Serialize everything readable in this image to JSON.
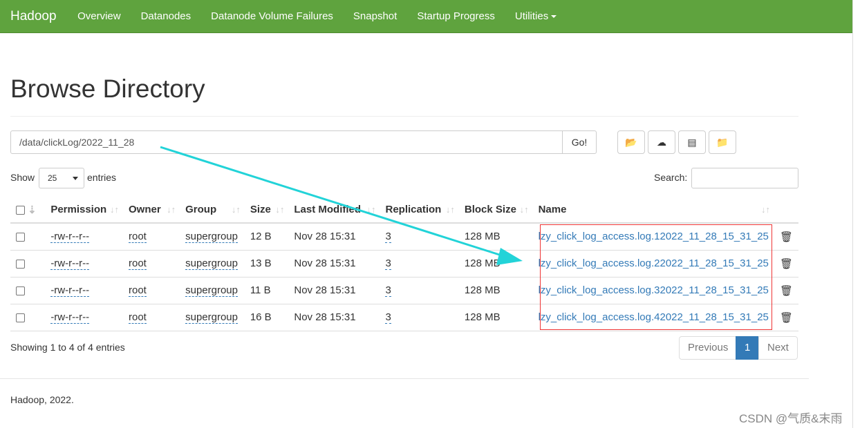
{
  "nav": {
    "brand": "Hadoop",
    "items": [
      "Overview",
      "Datanodes",
      "Datanode Volume Failures",
      "Snapshot",
      "Startup Progress",
      "Utilities"
    ]
  },
  "page_title": "Browse Directory",
  "path_value": "/data/clickLog/2022_11_28",
  "go_label": "Go!",
  "toolbar": [
    "folder-open-icon",
    "cloud-upload-icon",
    "list-alt-icon",
    "folder-new-icon"
  ],
  "show_label": "Show",
  "page_size": "25",
  "entries_label": "entries",
  "search_label": "Search:",
  "columns": [
    "Permission",
    "Owner",
    "Group",
    "Size",
    "Last Modified",
    "Replication",
    "Block Size",
    "Name"
  ],
  "rows": [
    {
      "perm": "-rw-r--r--",
      "owner": "root",
      "group": "supergroup",
      "size": "12 B",
      "mod": "Nov 28 15:31",
      "rep": "3",
      "block": "128 MB",
      "name": "lzy_click_log_access.log.12022_11_28_15_31_25"
    },
    {
      "perm": "-rw-r--r--",
      "owner": "root",
      "group": "supergroup",
      "size": "13 B",
      "mod": "Nov 28 15:31",
      "rep": "3",
      "block": "128 MB",
      "name": "lzy_click_log_access.log.22022_11_28_15_31_25"
    },
    {
      "perm": "-rw-r--r--",
      "owner": "root",
      "group": "supergroup",
      "size": "11 B",
      "mod": "Nov 28 15:31",
      "rep": "3",
      "block": "128 MB",
      "name": "lzy_click_log_access.log.32022_11_28_15_31_25"
    },
    {
      "perm": "-rw-r--r--",
      "owner": "root",
      "group": "supergroup",
      "size": "16 B",
      "mod": "Nov 28 15:31",
      "rep": "3",
      "block": "128 MB",
      "name": "lzy_click_log_access.log.42022_11_28_15_31_25"
    }
  ],
  "info": "Showing 1 to 4 of 4 entries",
  "pagination": {
    "prev": "Previous",
    "current": "1",
    "next": "Next"
  },
  "footer": "Hadoop, 2022.",
  "watermark": "CSDN @气质&末雨",
  "colors": {
    "navbar": "#5fa33e",
    "link": "#337ab7",
    "annotation_arrow": "#22d3d8",
    "annotation_box": "#ee3333"
  }
}
